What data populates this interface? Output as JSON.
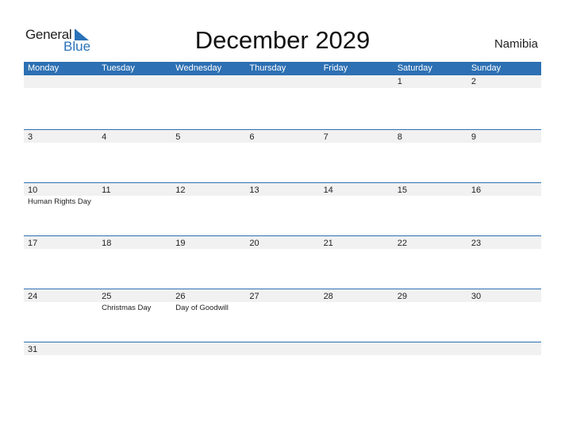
{
  "logo": {
    "general": "General",
    "blue": "Blue"
  },
  "title": "December 2029",
  "country": "Namibia",
  "colors": {
    "accent": "#2d70b3",
    "strip": "#f1f1f1"
  },
  "weekdays": [
    "Monday",
    "Tuesday",
    "Wednesday",
    "Thursday",
    "Friday",
    "Saturday",
    "Sunday"
  ],
  "weeks": [
    [
      {
        "d": ""
      },
      {
        "d": ""
      },
      {
        "d": ""
      },
      {
        "d": ""
      },
      {
        "d": ""
      },
      {
        "d": "1"
      },
      {
        "d": "2"
      }
    ],
    [
      {
        "d": "3"
      },
      {
        "d": "4"
      },
      {
        "d": "5"
      },
      {
        "d": "6"
      },
      {
        "d": "7"
      },
      {
        "d": "8"
      },
      {
        "d": "9"
      }
    ],
    [
      {
        "d": "10",
        "h": "Human Rights Day"
      },
      {
        "d": "11"
      },
      {
        "d": "12"
      },
      {
        "d": "13"
      },
      {
        "d": "14"
      },
      {
        "d": "15"
      },
      {
        "d": "16"
      }
    ],
    [
      {
        "d": "17"
      },
      {
        "d": "18"
      },
      {
        "d": "19"
      },
      {
        "d": "20"
      },
      {
        "d": "21"
      },
      {
        "d": "22"
      },
      {
        "d": "23"
      }
    ],
    [
      {
        "d": "24"
      },
      {
        "d": "25",
        "h": "Christmas Day"
      },
      {
        "d": "26",
        "h": "Day of Goodwill"
      },
      {
        "d": "27"
      },
      {
        "d": "28"
      },
      {
        "d": "29"
      },
      {
        "d": "30"
      }
    ],
    [
      {
        "d": "31"
      },
      {
        "d": ""
      },
      {
        "d": ""
      },
      {
        "d": ""
      },
      {
        "d": ""
      },
      {
        "d": ""
      },
      {
        "d": ""
      }
    ]
  ]
}
